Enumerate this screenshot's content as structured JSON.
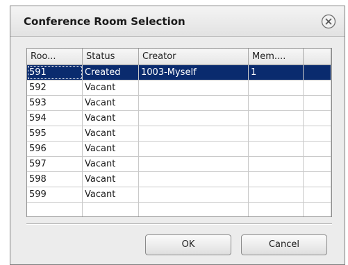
{
  "dialog": {
    "title": "Conference Room Selection",
    "close_icon": "close-circle-x-icon"
  },
  "table": {
    "columns": [
      "Roo...",
      "Status",
      "Creator",
      "Mem...."
    ],
    "rows": [
      {
        "room": "591",
        "status": "Created",
        "creator": "1003-Myself",
        "members": "1",
        "selected": true
      },
      {
        "room": "592",
        "status": "Vacant",
        "creator": "",
        "members": ""
      },
      {
        "room": "593",
        "status": "Vacant",
        "creator": "",
        "members": ""
      },
      {
        "room": "594",
        "status": "Vacant",
        "creator": "",
        "members": ""
      },
      {
        "room": "595",
        "status": "Vacant",
        "creator": "",
        "members": ""
      },
      {
        "room": "596",
        "status": "Vacant",
        "creator": "",
        "members": ""
      },
      {
        "room": "597",
        "status": "Vacant",
        "creator": "",
        "members": ""
      },
      {
        "room": "598",
        "status": "Vacant",
        "creator": "",
        "members": ""
      },
      {
        "room": "599",
        "status": "Vacant",
        "creator": "",
        "members": ""
      }
    ]
  },
  "buttons": {
    "ok_label": "OK",
    "cancel_label": "Cancel"
  },
  "colors": {
    "selection": "#0a2b6e",
    "dialog_bg": "#ececec"
  }
}
